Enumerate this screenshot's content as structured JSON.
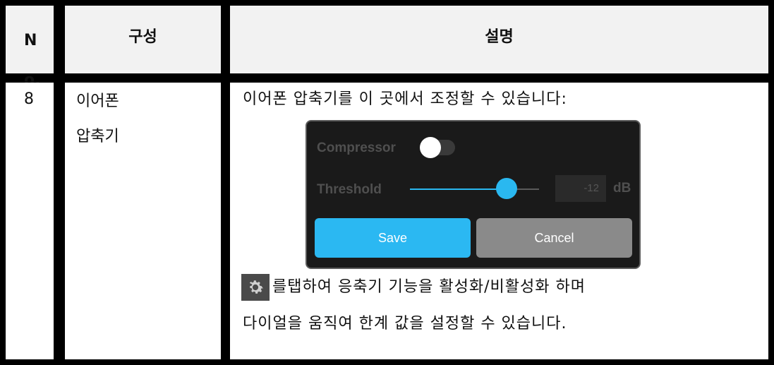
{
  "header": {
    "no_label": "N\no.",
    "component_label": "구성",
    "description_label": "설명"
  },
  "row": {
    "number": "8",
    "component": "이어폰\n압축기",
    "description_line1": "이어폰 압축기를 이 곳에서 조정할 수 있습니다:",
    "description_line2": "를탭하여 응축기 기능을 활성화/비활성화 하며",
    "description_line3": "다이얼을 움직여 한계 값을 설정할 수 있습니다."
  },
  "dialog": {
    "compressor_label": "Compressor",
    "compressor_enabled": true,
    "threshold_label": "Threshold",
    "threshold_value": "-12",
    "threshold_unit": "dB",
    "slider_fraction": 0.75,
    "save_label": "Save",
    "cancel_label": "Cancel"
  },
  "icons": {
    "settings": "gear-icon"
  },
  "colors": {
    "accent": "#2bb8f2",
    "cancel": "#8a8a8a",
    "dialog_bg": "#1a1a1a"
  }
}
